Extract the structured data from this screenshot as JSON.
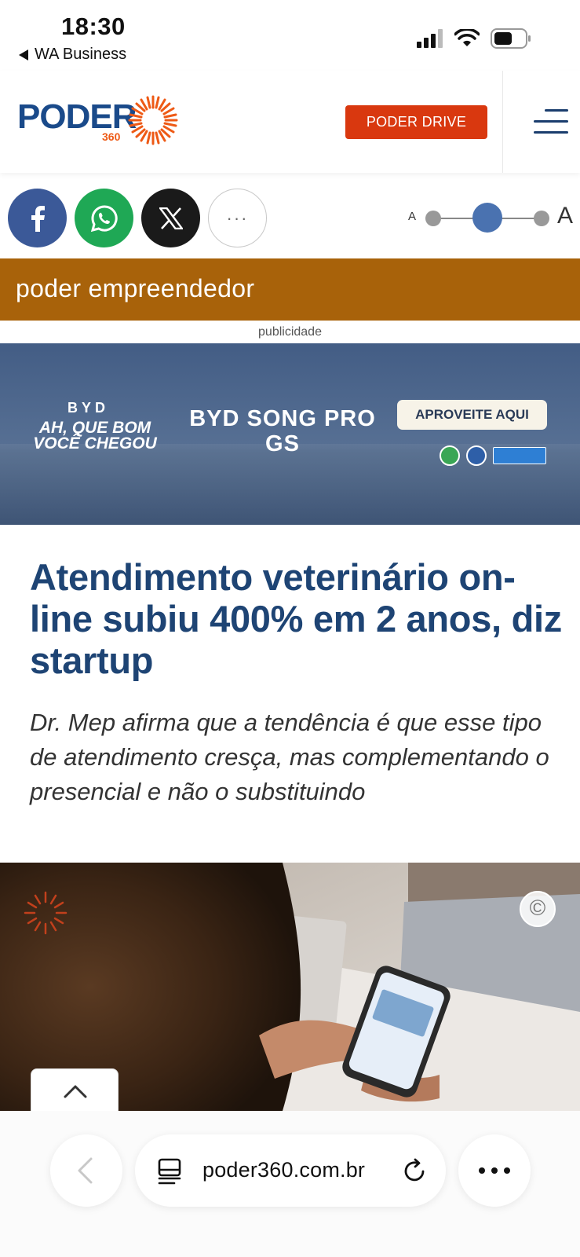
{
  "status_bar": {
    "time": "18:30",
    "back_app": "WA Business",
    "icons": [
      "signal-icon",
      "wifi-icon",
      "battery-icon"
    ]
  },
  "header": {
    "logo_word": "PODER",
    "logo_number": "360",
    "drive_button": "PODER DRIVE",
    "menu_icon": "hamburger-menu-icon"
  },
  "share": {
    "buttons": [
      "facebook-icon",
      "whatsapp-icon",
      "x-icon",
      "more-icon"
    ],
    "more_label": "···",
    "font_small": "A",
    "font_large": "A"
  },
  "section": {
    "title": "poder empreendedor"
  },
  "ad": {
    "label": "publicidade",
    "brand": "BYD",
    "slogan": "AH, QUE BOM VOCÊ CHEGOU",
    "model": "BYD SONG PRO GS",
    "cta": "APROVEITE AQUI"
  },
  "article": {
    "headline": "Atendimento veterinário on-line subiu 400% em 2 anos, diz startup",
    "subhead": "Dr. Mep afirma que a tendência é que esse tipo de atendimento cresça, mas complementando o presencial e não o substituindo",
    "photo_copyright": "©"
  },
  "browser": {
    "url": "poder360.com.br",
    "icons": [
      "back-arrow-icon",
      "page-icon",
      "reload-icon",
      "more-icon",
      "scroll-top-icon"
    ]
  },
  "colors": {
    "brand_blue": "#1a4a8a",
    "brand_orange": "#ee5a16",
    "drive_red": "#d9380f",
    "section_band": "#a8620a",
    "headline_blue": "#1e4474",
    "facebook": "#3b5998",
    "whatsapp": "#1fa855"
  }
}
